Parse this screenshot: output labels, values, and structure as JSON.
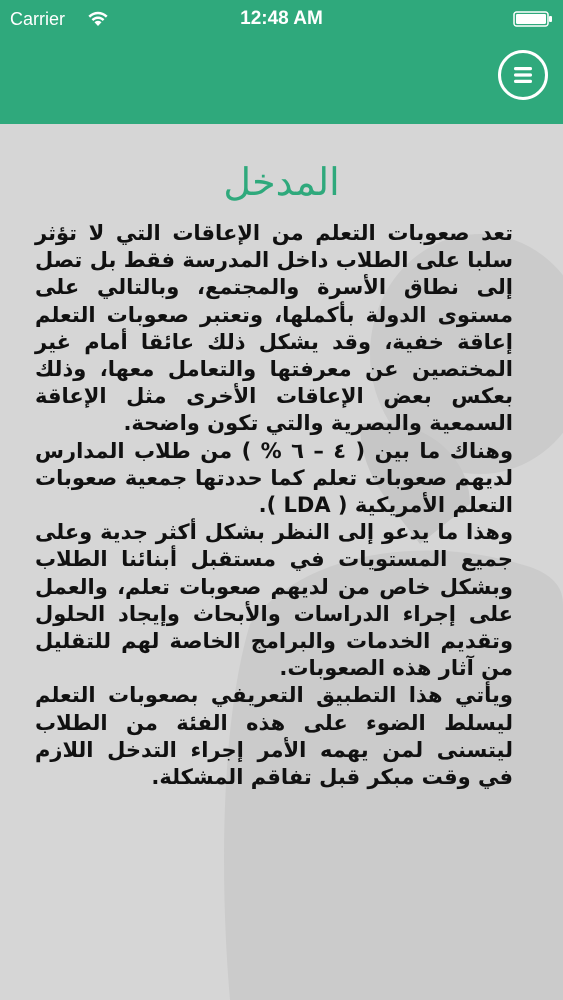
{
  "status_bar": {
    "carrier": "Carrier",
    "time": "12:48 AM",
    "wifi_icon": "wifi-icon",
    "battery_icon": "battery-icon"
  },
  "nav_bar": {
    "menu_icon": "hamburger-menu-icon",
    "color": "#2fa97c"
  },
  "page": {
    "title": "المدخل",
    "paragraphs": [
      "تعد صعوبات التعلم من الإعاقات التي لا تؤثر سلبا على الطلاب داخل المدرسة فقط بل تصل إلى نطاق الأسرة والمجتمع، وبالتالي على مستوى الدولة بأكملها، وتعتبر صعوبات التعلم إعاقة خفية، وقد يشكل ذلك عائقا أمام غير المختصين عن معرفتها والتعامل معها، وذلك بعكس بعض الإعاقات الأخرى مثل الإعاقة السمعية والبصرية والتي تكون واضحة.",
      "وهناك ما بين ( ٤ – ٦ % ) من طلاب المدارس لديهم صعوبات تعلم كما حددتها جمعية صعوبات التعلم الأمريكية ( LDA ).",
      "وهذا ما يدعو إلى النظر بشكل أكثر جدية وعلى جميع المستويات في مستقبل أبنائنا الطلاب وبشكل خاص من لديهم صعوبات تعلم، والعمل على إجراء الدراسات والأبحاث وإيجاد الحلول وتقديم الخدمات والبرامج الخاصة لهم للتقليل من آثار هذه الصعوبات.",
      "ويأتي هذا التطبيق التعريفي بصعوبات التعلم ليسلط الضوء على هذه الفئة من الطلاب ليتسنى لمن يهمه الأمر إجراء التدخل اللازم في وقت مبكر قبل تفاقم المشكلة."
    ]
  },
  "colors": {
    "accent": "#2fa97c",
    "background": "#d6d6d6",
    "text": "#111111"
  }
}
